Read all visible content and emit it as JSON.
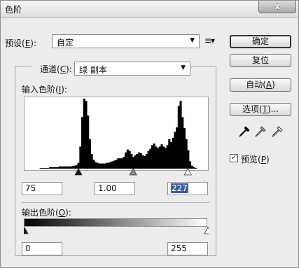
{
  "window": {
    "title": "色阶",
    "close_label": "x"
  },
  "preset": {
    "label": "预设(",
    "mnemonic": "E",
    "suffix": "):",
    "value": "自定"
  },
  "channel": {
    "label": "通道(",
    "mnemonic": "C",
    "suffix": "):",
    "value": "绿 副本"
  },
  "input_levels": {
    "label": "输入色阶(",
    "mnemonic": "I",
    "suffix": "):",
    "black": "75",
    "gamma": "1.00",
    "white": "227"
  },
  "output_levels": {
    "label": "输出色阶(",
    "mnemonic": "O",
    "suffix": "):",
    "black": "0",
    "white": "255"
  },
  "buttons": {
    "ok": "确定",
    "reset": "复位",
    "auto": {
      "text": "自动(",
      "mnemonic": "A",
      "suffix": ")"
    },
    "options": {
      "text": "选项(",
      "mnemonic": "T",
      "suffix": ")..."
    }
  },
  "preview": {
    "text": "预览(",
    "mnemonic": "P",
    "suffix": ")",
    "checked": true
  },
  "icons": [
    "close-icon",
    "dropdown-caret-icon",
    "preset-options-icon",
    "black-eyedropper-icon",
    "gray-eyedropper-icon",
    "white-eyedropper-icon",
    "checkmark-icon"
  ],
  "histogram": {
    "max_value": 255,
    "input_black": 75,
    "input_gray": 1.0,
    "input_white": 227,
    "output_black": 0,
    "output_white": 255,
    "bins": [
      0,
      0,
      0,
      0,
      0,
      0,
      0,
      0,
      1,
      1,
      1,
      1,
      1,
      2,
      2,
      2,
      2,
      2,
      3,
      3,
      3,
      3,
      3,
      3,
      3,
      4,
      4,
      5,
      8,
      30,
      70,
      95,
      92,
      72,
      40,
      20,
      12,
      9,
      8,
      7,
      7,
      7,
      7,
      8,
      8,
      9,
      10,
      11,
      12,
      14,
      14,
      14,
      16,
      22,
      26,
      24,
      20,
      16,
      18,
      20,
      22,
      21,
      18,
      17,
      20,
      24,
      27,
      32,
      34,
      30,
      28,
      30,
      33,
      30,
      28,
      32,
      40,
      36,
      42,
      50,
      56,
      85,
      92,
      70,
      55,
      40,
      25,
      10,
      4,
      2,
      1,
      0,
      0,
      0,
      0,
      0,
      0
    ]
  }
}
